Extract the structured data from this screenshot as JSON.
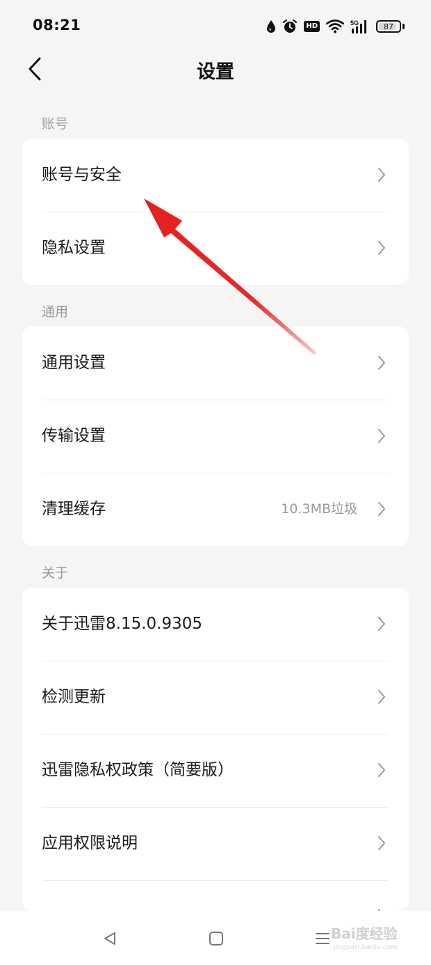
{
  "status_bar": {
    "time": "08:21",
    "icons": [
      "water-drop-icon",
      "alarm-icon",
      "hd-icon",
      "wifi-icon",
      "5g-signal-icon",
      "battery-icon"
    ],
    "hd_text": "HD",
    "network": "5G",
    "battery": "87",
    "battery_level": 0.87
  },
  "header": {
    "back_icon": "chevron-left-icon",
    "title": "设置"
  },
  "sections": [
    {
      "label": "账号",
      "rows": [
        {
          "label": "账号与安全"
        },
        {
          "label": "隐私设置"
        }
      ]
    },
    {
      "label": "通用",
      "rows": [
        {
          "label": "通用设置"
        },
        {
          "label": "传输设置"
        },
        {
          "label": "清理缓存",
          "value": "10.3MB垃圾"
        }
      ]
    },
    {
      "label": "关于",
      "rows": [
        {
          "label": "关于迅雷8.15.0.9305"
        },
        {
          "label": "检测更新"
        },
        {
          "label": "迅雷隐私权政策（简要版）"
        },
        {
          "label": "应用权限说明"
        }
      ]
    }
  ],
  "annotation": {
    "type": "red-arrow",
    "color": "#e41f1f"
  },
  "bottom_nav": {
    "keys": [
      "back-triangle-icon",
      "home-square-icon",
      "menu-lines-icon"
    ]
  },
  "watermark": {
    "text": "Bai度经验",
    "sub": "jingyan.baidu.com"
  }
}
